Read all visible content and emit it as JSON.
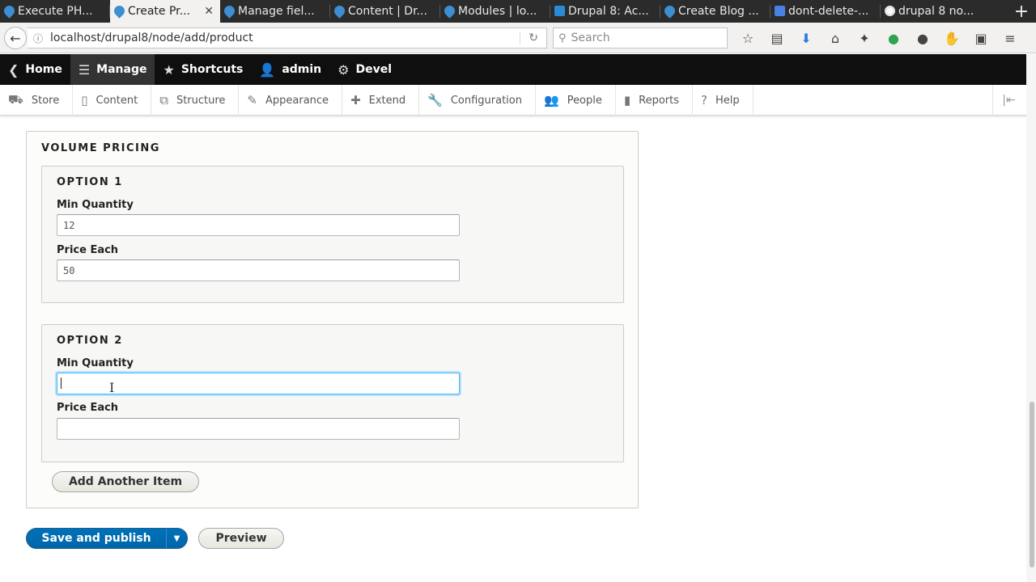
{
  "browser": {
    "tabs": [
      {
        "title": "Execute PH...",
        "favicon": "drupal-icon",
        "active": false
      },
      {
        "title": "Create Pr...",
        "favicon": "drupal-icon",
        "active": true
      },
      {
        "title": "Manage fiel...",
        "favicon": "drupal-icon",
        "active": false
      },
      {
        "title": "Content | Dr...",
        "favicon": "drupal-icon",
        "active": false
      },
      {
        "title": "Modules | lo...",
        "favicon": "drupal-icon",
        "active": false
      },
      {
        "title": "Drupal 8: Ac...",
        "favicon": "codeforest-icon",
        "active": false
      },
      {
        "title": "Create Blog ...",
        "favicon": "drupal-icon",
        "active": false
      },
      {
        "title": "dont-delete-...",
        "favicon": "docs-icon",
        "active": false
      },
      {
        "title": "drupal 8 no...",
        "favicon": "google-icon",
        "active": false
      }
    ],
    "tab_close": "✕",
    "new_tab": "+",
    "url": "localhost/drupal8/node/add/product",
    "search_placeholder": "Search"
  },
  "toolbar": {
    "items": [
      {
        "label": "Home",
        "icon": "home-icon"
      },
      {
        "label": "Manage",
        "icon": "menu-icon"
      },
      {
        "label": "Shortcuts",
        "icon": "star-icon"
      },
      {
        "label": "admin",
        "icon": "user-icon"
      },
      {
        "label": "Devel",
        "icon": "gear-icon"
      }
    ]
  },
  "tray": {
    "items": [
      {
        "label": "Store",
        "icon": "store-icon"
      },
      {
        "label": "Content",
        "icon": "content-icon"
      },
      {
        "label": "Structure",
        "icon": "structure-icon"
      },
      {
        "label": "Appearance",
        "icon": "appearance-icon"
      },
      {
        "label": "Extend",
        "icon": "extend-icon"
      },
      {
        "label": "Configuration",
        "icon": "wrench-icon"
      },
      {
        "label": "People",
        "icon": "people-icon"
      },
      {
        "label": "Reports",
        "icon": "reports-icon"
      },
      {
        "label": "Help",
        "icon": "help-icon"
      }
    ]
  },
  "form": {
    "section_title": "VOLUME PRICING",
    "options": [
      {
        "title": "OPTION 1",
        "min_quantity_label": "Min Quantity",
        "min_quantity_value": "12",
        "price_label": "Price Each",
        "price_value": "50"
      },
      {
        "title": "OPTION 2",
        "min_quantity_label": "Min Quantity",
        "min_quantity_value": "",
        "price_label": "Price Each",
        "price_value": ""
      }
    ],
    "add_another_label": "Add Another Item",
    "save_label": "Save and publish",
    "preview_label": "Preview"
  },
  "colors": {
    "toolbar_bg": "#0f0f0f",
    "primary_button": "#0071b8",
    "focus_ring": "#40b6ff"
  }
}
